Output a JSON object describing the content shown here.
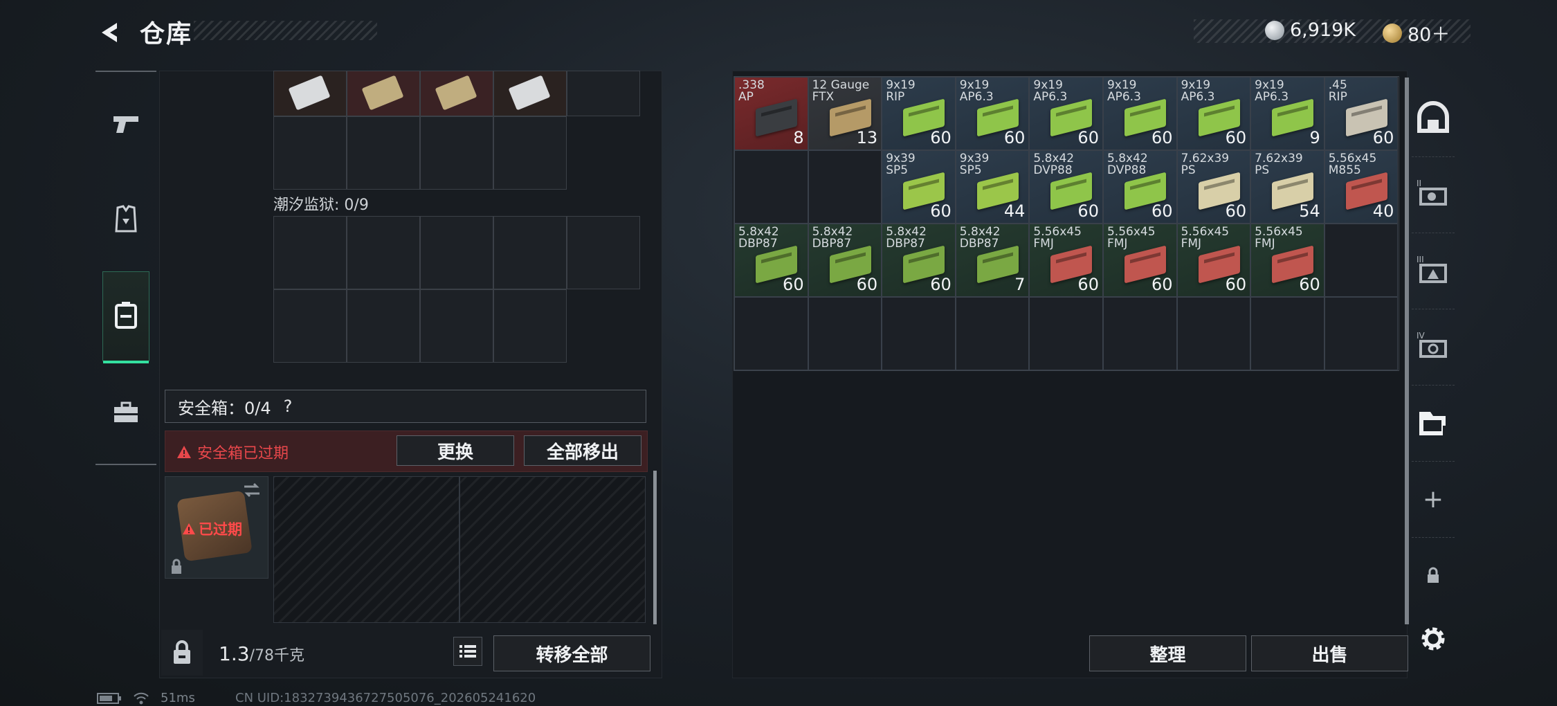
{
  "header": {
    "title": "仓库",
    "currencies": [
      {
        "icon": "silver-coin-icon",
        "value": "6,919K"
      },
      {
        "icon": "gold-coin-icon",
        "value": "80＋"
      }
    ]
  },
  "left_tabs": [
    {
      "name": "weapon-tab",
      "icon": "pistol-icon"
    },
    {
      "name": "armor-tab",
      "icon": "vest-icon"
    },
    {
      "name": "backpack-tab",
      "icon": "backpack-icon",
      "selected": true
    },
    {
      "name": "toolbox-tab",
      "icon": "toolbox-icon"
    }
  ],
  "left_panel": {
    "prison_label": "潮汐监狱: 0/9",
    "safe_box": {
      "label": "安全箱：",
      "count": "0/4",
      "help": "?",
      "expired_text": "安全箱已过期",
      "badge_text": "已过期",
      "replace_label": "更换",
      "move_all_label": "全部移出"
    },
    "weight_value": "1.3",
    "weight_max": "/78千克",
    "transfer_all_label": "转移全部"
  },
  "inventory": {
    "rows": [
      [
        {
          "name": ".338\nAP",
          "count": "8",
          "color": "red",
          "box": "#3a3d41"
        },
        {
          "name": "12 Gauge\nFTX",
          "count": "13",
          "color": "tan",
          "box": "#b59a67"
        },
        {
          "name": "9x19\nRIP",
          "count": "60",
          "color": "blue",
          "box": "#8fc54a"
        },
        {
          "name": "9x19\nAP6.3",
          "count": "60",
          "color": "blue",
          "box": "#8fc54a"
        },
        {
          "name": "9x19\nAP6.3",
          "count": "60",
          "color": "blue",
          "box": "#8fc54a"
        },
        {
          "name": "9x19\nAP6.3",
          "count": "60",
          "color": "blue",
          "box": "#8fc54a"
        },
        {
          "name": "9x19\nAP6.3",
          "count": "60",
          "color": "blue",
          "box": "#8fc54a"
        },
        {
          "name": "9x19\nAP6.3",
          "count": "9",
          "color": "blue",
          "box": "#8fc54a"
        },
        {
          "name": ".45\nRIP",
          "count": "60",
          "color": "blue",
          "box": "#c9c3b3"
        }
      ],
      [
        {
          "name": "",
          "count": "",
          "color": "empty"
        },
        {
          "name": "",
          "count": "",
          "color": "empty"
        },
        {
          "name": "9x39\nSP5",
          "count": "60",
          "color": "blue",
          "box": "#9bc64a"
        },
        {
          "name": "9x39\nSP5",
          "count": "44",
          "color": "blue",
          "box": "#9bc64a"
        },
        {
          "name": "5.8x42\nDVP88",
          "count": "60",
          "color": "blue",
          "box": "#8fc54a"
        },
        {
          "name": "5.8x42\nDVP88",
          "count": "60",
          "color": "blue",
          "box": "#8fc54a"
        },
        {
          "name": "7.62x39\nPS",
          "count": "60",
          "color": "blue",
          "box": "#d8cfa8"
        },
        {
          "name": "7.62x39\nPS",
          "count": "54",
          "color": "blue",
          "box": "#d8cfa8"
        },
        {
          "name": "5.56x45\nM855",
          "count": "40",
          "color": "blue",
          "box": "#c0564f"
        }
      ],
      [
        {
          "name": "5.8x42\nDBP87",
          "count": "60",
          "color": "green",
          "box": "#7aa843"
        },
        {
          "name": "5.8x42\nDBP87",
          "count": "60",
          "color": "green",
          "box": "#7aa843"
        },
        {
          "name": "5.8x42\nDBP87",
          "count": "60",
          "color": "green",
          "box": "#7aa843"
        },
        {
          "name": "5.8x42\nDBP87",
          "count": "7",
          "color": "green",
          "box": "#7aa843"
        },
        {
          "name": "5.56x45\nFMJ",
          "count": "60",
          "color": "green",
          "box": "#c0564f"
        },
        {
          "name": "5.56x45\nFMJ",
          "count": "60",
          "color": "green",
          "box": "#c0564f"
        },
        {
          "name": "5.56x45\nFMJ",
          "count": "60",
          "color": "green",
          "box": "#c0564f"
        },
        {
          "name": "5.56x45\nFMJ",
          "count": "60",
          "color": "green",
          "box": "#c0564f"
        },
        {
          "name": "",
          "count": "",
          "color": "empty"
        }
      ],
      [
        {
          "name": "",
          "count": "",
          "color": "empty"
        },
        {
          "name": "",
          "count": "",
          "color": "empty"
        },
        {
          "name": "",
          "count": "",
          "color": "empty"
        },
        {
          "name": "",
          "count": "",
          "color": "empty"
        },
        {
          "name": "",
          "count": "",
          "color": "empty"
        },
        {
          "name": "",
          "count": "",
          "color": "empty"
        },
        {
          "name": "",
          "count": "",
          "color": "empty"
        },
        {
          "name": "",
          "count": "",
          "color": "empty"
        },
        {
          "name": "",
          "count": "",
          "color": "empty"
        }
      ]
    ],
    "sort_label": "整理",
    "sell_label": "出售"
  },
  "right_tabs": [
    {
      "name": "storage-tab-1",
      "icon": "dome-icon"
    },
    {
      "name": "storage-tab-2",
      "icon": "storage-ii-icon"
    },
    {
      "name": "storage-tab-3",
      "icon": "storage-iii-icon"
    },
    {
      "name": "storage-tab-4",
      "icon": "storage-iv-icon"
    },
    {
      "name": "storage-tab-5",
      "icon": "folder-icon",
      "selected": true
    },
    {
      "name": "add-storage-button",
      "icon": "plus-icon"
    },
    {
      "name": "locked-storage",
      "icon": "lock-icon"
    }
  ],
  "status_bar": {
    "ping": "51ms",
    "uid": "CN UID:1832739436727505076_202605241620"
  },
  "colors": {
    "accent_green": "#34e0a0",
    "expired_red": "#e8474b",
    "cell_blue": "#2d3c4b",
    "cell_green": "#253a2f",
    "cell_red": "#7a2a2c"
  }
}
